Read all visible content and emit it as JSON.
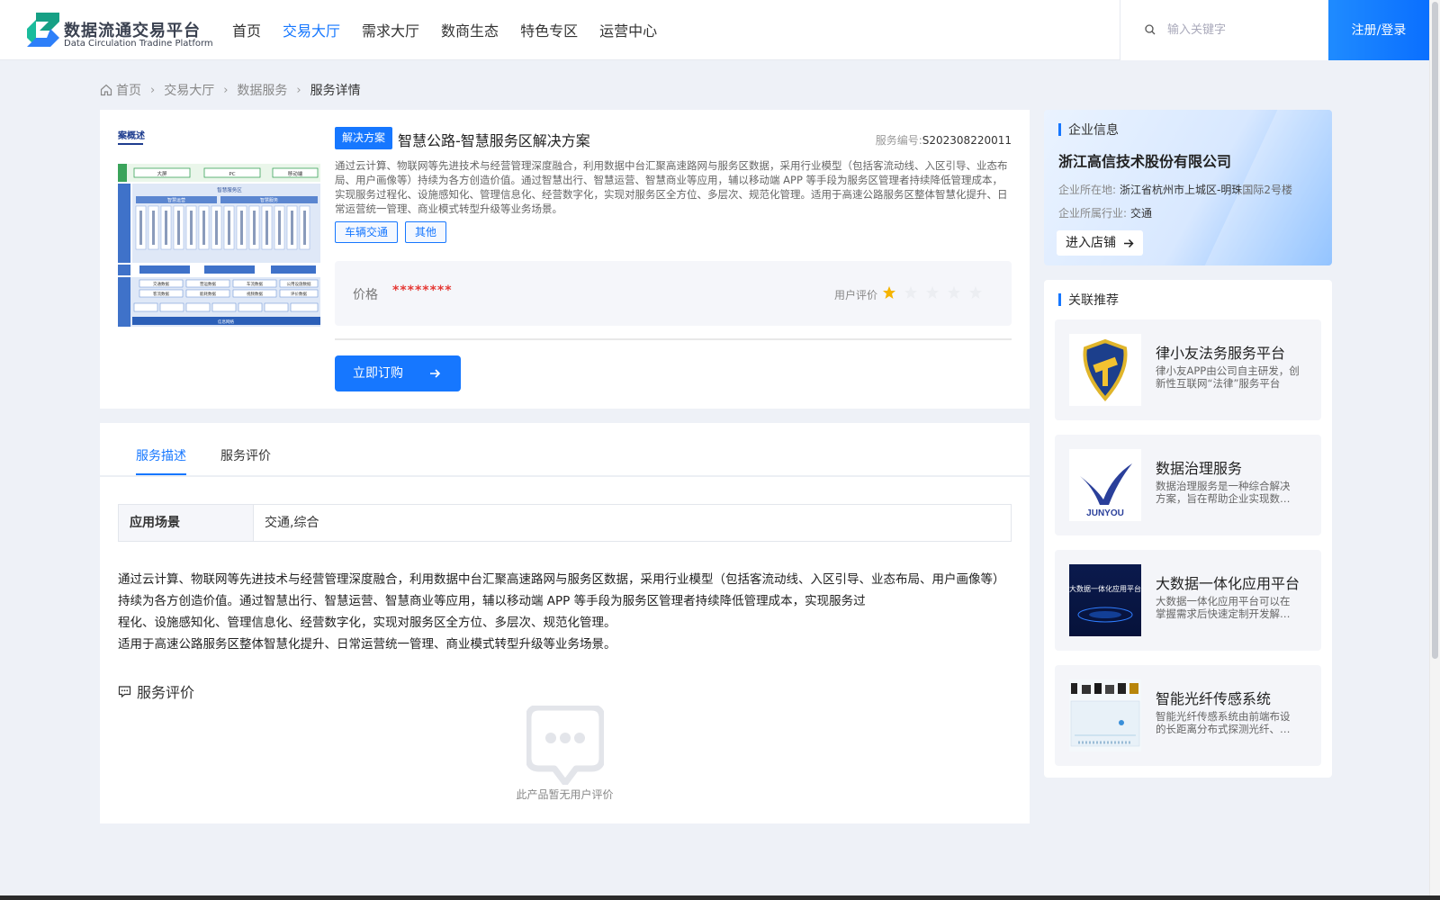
{
  "header": {
    "logo_name": "数据流通交易平台",
    "logo_en": "Data Circulation Tradine Platform",
    "nav": [
      "首页",
      "交易大厅",
      "需求大厅",
      "数商生态",
      "特色专区",
      "运营中心"
    ],
    "active_nav": "交易大厅",
    "search_placeholder": "输入关键字",
    "login_label": "注册/登录"
  },
  "breadcrumb": [
    "首页",
    "交易大厅",
    "数据服务",
    "服务详情"
  ],
  "product": {
    "thumbnail_caption": "案概述",
    "thumbnail_labels": {
      "top": [
        "大屏",
        "PC",
        "移动端"
      ],
      "zone": "智慧服务区",
      "groups": [
        "智慧运营",
        "智慧服务"
      ],
      "bottom": [
        "交通数据",
        "营运数据",
        "车流数据",
        "公用设施数据",
        "客流数据",
        "能耗数据",
        "视频数据",
        "评价数据"
      ],
      "footer": "信息网络"
    },
    "tag": "解决方案",
    "title": "智慧公路-智慧服务区解决方案",
    "service_no_label": "服务编号:",
    "service_no": "S202308220011",
    "description": "通过云计算、物联网等先进技术与经营管理深度融合，利用数据中台汇聚高速路网与服务区数据，采用行业模型（包括客流动线、入区引导、业态布局、用户画像等）持续为各方创造价值。通过智慧出行、智慧运营、智慧商业等应用，辅以移动端 APP 等手段为服务区管理者持续降低管理成本，实现服务过程化、设施感知化、管理信息化、经营数字化，实现对服务区全方位、多层次、规范化管理。适用于高速公路服务区整体智慧化提升、日常运营统一管理、商业模式转型升级等业务场景。",
    "category_tags": [
      "车辆交通",
      "其他"
    ],
    "price_label": "价格",
    "price_value": "********",
    "rating_label": "用户评价",
    "rating": 1,
    "rating_max": 5,
    "order_label": "立即订购",
    "accent_color": "#1677ff"
  },
  "tabs": [
    "服务描述",
    "服务评价"
  ],
  "active_tab": "服务描述",
  "detail": {
    "scene_label": "应用场景",
    "scene_value": "交通,综合",
    "paragraphs": [
      "通过云计算、物联网等先进技术与经营管理深度融合，利用数据中台汇聚高速路网与服务区数据，采用行业模型（包括客流动线、入区引导、业态布局、用户画像等）持续为各方创造价值。通过智慧出行、智慧运营、智慧商业等应用，辅以移动端 APP 等手段为服务区管理者持续降低管理成本，实现服务过",
      "程化、设施感知化、管理信息化、经营数字化，实现对服务区全方位、多层次、规范化管理。",
      "适用于高速公路服务区整体智慧化提升、日常运营统一管理、商业模式转型升级等业务场景。"
    ],
    "review_title": "服务评价",
    "empty_text": "此产品暂无用户评价"
  },
  "company": {
    "section_title": "企业信息",
    "name": "浙江高信技术股份有限公司",
    "location_label": "企业所在地:",
    "location": "浙江省杭州市上城区-明珠国际2号楼",
    "industry_label": "企业所属行业:",
    "industry": "交通",
    "store_label": "进入店铺"
  },
  "recommend": {
    "section_title": "关联推荐",
    "items": [
      {
        "name": "律小友法务服务平台",
        "desc": "律小友APP由公司自主研发，创新性互联网“法律”服务平台"
      },
      {
        "name": "数据治理服务",
        "desc": "数据治理服务是一种综合解决方案，旨在帮助企业实现数据资产"
      },
      {
        "name": "大数据一体化应用平台",
        "desc": "大数据一体化应用平台可以在掌握需求后快速定制开发解决方案"
      },
      {
        "name": "智能光纤传感系统",
        "desc": "智能光纤传感系统由前端布设的长距离分布式探测光纤、后端设备"
      }
    ],
    "logo_texts": {
      "junyou": "JUNYOU",
      "bigdata": "大数据一体化应用平台"
    }
  }
}
